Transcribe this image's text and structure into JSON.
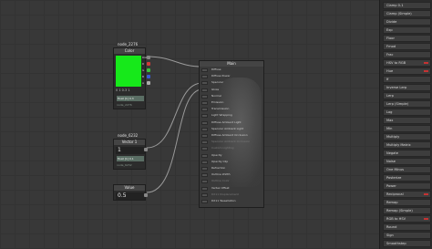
{
  "nodes": {
    "color": {
      "name": "node_2276",
      "header": "Color",
      "swatch_color": "#16e91a",
      "ports": [
        "RGB",
        "R",
        "G",
        "B",
        "A"
      ],
      "values": "0    1    0.3    1",
      "tag": "float [1] 0.3",
      "sub": "node_2276"
    },
    "vector1": {
      "name": "node_6232",
      "header": "Vector 1",
      "value": "1",
      "tag": "float [1] 0.1",
      "sub": "node_6232"
    },
    "value": {
      "header": "Value",
      "value": "0.5"
    },
    "main": {
      "header": "Main",
      "inputs": [
        {
          "label": "Diffuse",
          "dim": false
        },
        {
          "label": "Diffuse Power",
          "dim": false
        },
        {
          "label": "Specular",
          "dim": false
        },
        {
          "label": "Gloss",
          "dim": false
        },
        {
          "label": "Normal",
          "dim": false
        },
        {
          "label": "Emission",
          "dim": false
        },
        {
          "label": "Transmission",
          "dim": false
        },
        {
          "label": "Light Wrapping",
          "dim": false
        },
        {
          "label": "Diffuse Ambient Light",
          "dim": false
        },
        {
          "label": "Specular Ambient Light",
          "dim": false
        },
        {
          "label": "Diffuse Ambient Occlusion",
          "dim": false
        },
        {
          "label": "Specular Ambient Occlusion",
          "dim": true
        },
        {
          "label": "Custom Lighting",
          "dim": true
        },
        {
          "label": "Opacity",
          "dim": false
        },
        {
          "label": "Opacity Clip",
          "dim": false
        },
        {
          "label": "Refraction",
          "dim": false
        },
        {
          "label": "Outline Width",
          "dim": false
        },
        {
          "label": "Outline Color",
          "dim": true
        },
        {
          "label": "Vertex Offset",
          "dim": false
        },
        {
          "label": "DX11 Displacement",
          "dim": true
        },
        {
          "label": "DX11 Tessellation",
          "dim": false
        }
      ]
    }
  },
  "panel": {
    "items": [
      {
        "label": "Clamp 0-1",
        "badge": false
      },
      {
        "label": "Clamp (Simple)",
        "badge": false
      },
      {
        "label": "Divide",
        "badge": false
      },
      {
        "label": "Exp",
        "badge": false
      },
      {
        "label": "Floor",
        "badge": false
      },
      {
        "label": "Fmod",
        "badge": false
      },
      {
        "label": "Frac",
        "badge": false
      },
      {
        "label": "HSV to RGB",
        "badge": true
      },
      {
        "label": "Hue",
        "badge": true
      },
      {
        "label": "If",
        "badge": false
      },
      {
        "label": "Inverse Lerp",
        "badge": false
      },
      {
        "label": "Lerp",
        "badge": false
      },
      {
        "label": "Lerp (Simple)",
        "badge": false
      },
      {
        "label": "Log",
        "badge": false
      },
      {
        "label": "Max",
        "badge": false
      },
      {
        "label": "Min",
        "badge": false
      },
      {
        "label": "Multiply",
        "badge": false
      },
      {
        "label": "Multiply Matrix",
        "badge": false
      },
      {
        "label": "Negate",
        "badge": false
      },
      {
        "label": "Noise",
        "badge": false
      },
      {
        "label": "One Minus",
        "badge": false
      },
      {
        "label": "Posterize",
        "badge": false
      },
      {
        "label": "Power",
        "badge": false
      },
      {
        "label": "Reciprocal",
        "badge": true
      },
      {
        "label": "Remap",
        "badge": false
      },
      {
        "label": "Remap (Simple)",
        "badge": false
      },
      {
        "label": "RGB to HSV",
        "badge": true
      },
      {
        "label": "Round",
        "badge": false
      },
      {
        "label": "Sign",
        "badge": false
      },
      {
        "label": "Smoothstep",
        "badge": false
      }
    ]
  },
  "colors": {
    "canvas": "#383838",
    "wire": "#9a9a9a",
    "port_rgb": "#888888",
    "port_r": "#d23a3a",
    "port_g": "#3ac23a",
    "port_b": "#3a5ad2",
    "port_a": "#aaaaaa",
    "badge": "#c43333"
  }
}
